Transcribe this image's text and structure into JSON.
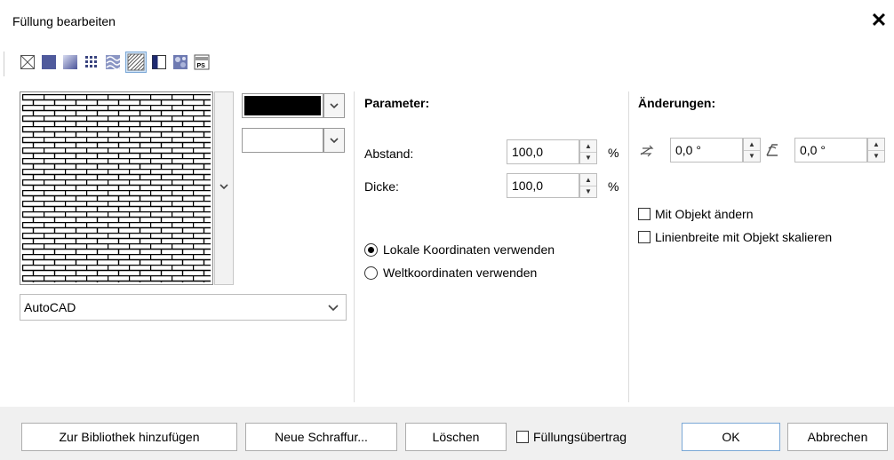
{
  "window": {
    "title": "Füllung bearbeiten"
  },
  "toolbar": {
    "icons": [
      "no-fill-icon",
      "uniform-fill-icon",
      "fountain-fill-icon",
      "vector-pattern-fill-icon",
      "bitmap-pattern-fill-icon",
      "hatch-fill-icon",
      "two-color-fill-icon",
      "texture-fill-icon",
      "postscript-fill-icon"
    ],
    "selected": "hatch-fill-icon"
  },
  "left": {
    "library_select": "AutoCAD",
    "foreground_color": "#000000",
    "background_color": "#ffffff"
  },
  "parameters": {
    "heading": "Parameter:",
    "spacing_label": "Abstand:",
    "spacing_value": "100,0",
    "spacing_unit": "%",
    "thickness_label": "Dicke:",
    "thickness_value": "100,0",
    "thickness_unit": "%",
    "radio_local": "Lokale Koordinaten verwenden",
    "radio_world": "Weltkoordinaten verwenden",
    "radio_selected": "local"
  },
  "changes": {
    "heading": "Änderungen:",
    "angle1_value": "0,0 °",
    "angle2_value": "0,0 °",
    "check_transform": "Mit Objekt ändern",
    "check_scale_line": "Linienbreite mit Objekt skalieren"
  },
  "footer": {
    "add_to_library": "Zur Bibliothek hinzufügen",
    "new_hatch": "Neue Schraffur...",
    "delete": "Löschen",
    "fill_copy": "Füllungsübertrag",
    "ok": "OK",
    "cancel": "Abbrechen"
  }
}
